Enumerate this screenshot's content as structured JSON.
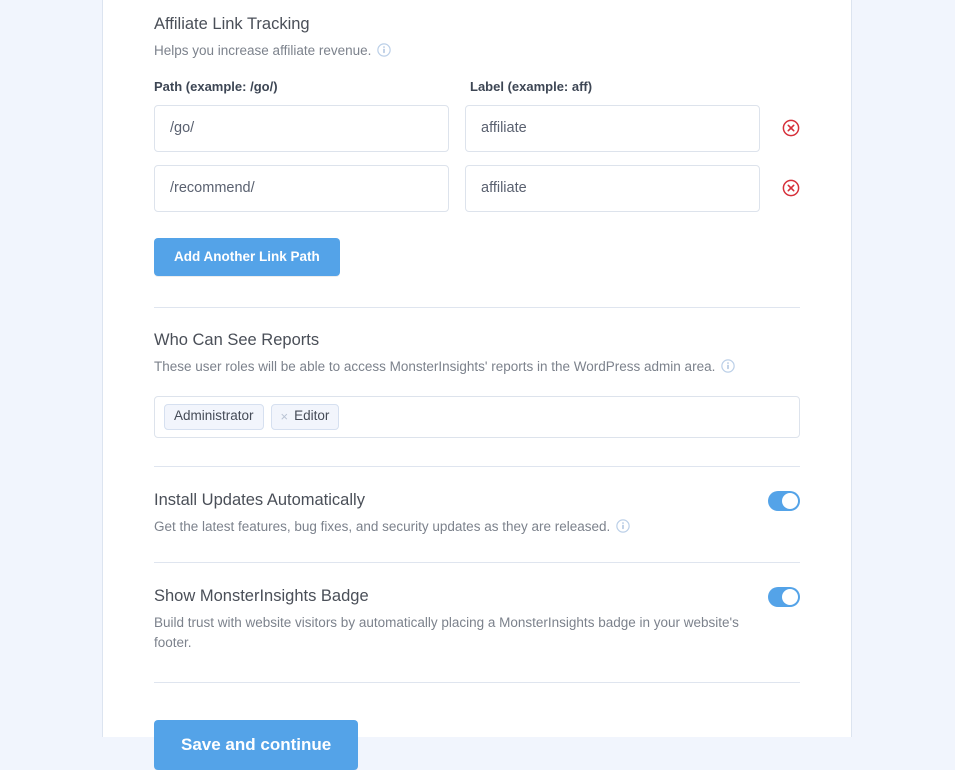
{
  "colors": {
    "page_background": "#f1f5fd",
    "card_background": "#ffffff",
    "accent_blue": "#54a3e8",
    "danger_red": "#d6303a",
    "divider": "#dfe5ef",
    "heading_text": "#4a4f58",
    "muted_text": "#7c828c"
  },
  "affiliate": {
    "title": "Affiliate Link Tracking",
    "description": "Helps you increase affiliate revenue.",
    "info_icon": "info-circle-icon",
    "path_column_label": "Path (example: /go/)",
    "label_column_label": "Label (example: aff)",
    "rows": [
      {
        "path": "/go/",
        "path_placeholder": "/go/",
        "label": "affiliate",
        "label_placeholder": "aff",
        "remove_icon": "remove-circle-icon"
      },
      {
        "path": "/recommend/",
        "path_placeholder": "/go/",
        "label": "affiliate",
        "label_placeholder": "aff",
        "remove_icon": "remove-circle-icon"
      }
    ],
    "add_button_label": "Add Another Link Path"
  },
  "roles": {
    "title": "Who Can See Reports",
    "description": "These user roles will be able to access MonsterInsights' reports in the WordPress admin area.",
    "info_icon": "info-circle-icon",
    "tags": [
      {
        "label": "Administrator",
        "removable": false
      },
      {
        "label": "Editor",
        "removable": true,
        "remove_icon": "times-icon",
        "remove_glyph": "×"
      }
    ]
  },
  "install_updates": {
    "title": "Install Updates Automatically",
    "description": "Get the latest features, bug fixes, and security updates as they are released.",
    "info_icon": "info-circle-icon",
    "toggle_state": "on"
  },
  "badge": {
    "title": "Show MonsterInsights Badge",
    "description": "Build trust with website visitors by automatically placing a MonsterInsights badge in your website's footer.",
    "toggle_state": "on"
  },
  "footer": {
    "save_button_label": "Save and continue"
  }
}
